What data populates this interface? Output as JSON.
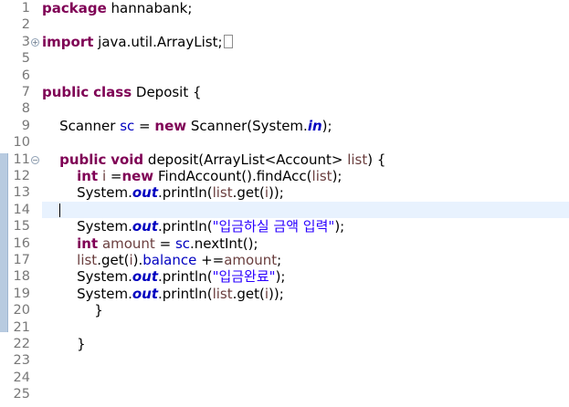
{
  "lines": [
    {
      "num": "1",
      "segments": [
        {
          "t": "package",
          "c": "kw"
        },
        {
          "t": " hannabank;"
        }
      ]
    },
    {
      "num": "2",
      "segments": []
    },
    {
      "num": "3",
      "fold": "+",
      "segments": [
        {
          "t": "import",
          "c": "kw"
        },
        {
          "t": " java.util.ArrayList;"
        }
      ],
      "collapsed": true
    },
    {
      "num": "5",
      "segments": []
    },
    {
      "num": "6",
      "segments": []
    },
    {
      "num": "7",
      "segments": [
        {
          "t": "public",
          "c": "kw"
        },
        {
          "t": " "
        },
        {
          "t": "class",
          "c": "kw"
        },
        {
          "t": " Deposit {"
        }
      ]
    },
    {
      "num": "8",
      "segments": []
    },
    {
      "num": "9",
      "segments": [
        {
          "t": "    Scanner "
        },
        {
          "t": "sc",
          "c": "field"
        },
        {
          "t": " = "
        },
        {
          "t": "new",
          "c": "kw"
        },
        {
          "t": " Scanner(System."
        },
        {
          "t": "in",
          "c": "sfield"
        },
        {
          "t": ");"
        }
      ]
    },
    {
      "num": "10",
      "segments": []
    },
    {
      "num": "11",
      "fold": "−",
      "segments": [
        {
          "t": "    "
        },
        {
          "t": "public",
          "c": "kw"
        },
        {
          "t": " "
        },
        {
          "t": "void",
          "c": "kw"
        },
        {
          "t": " deposit(ArrayList<Account> "
        },
        {
          "t": "list",
          "c": "var"
        },
        {
          "t": ") {"
        }
      ]
    },
    {
      "num": "12",
      "segments": [
        {
          "t": "        "
        },
        {
          "t": "int",
          "c": "kw"
        },
        {
          "t": " "
        },
        {
          "t": "i",
          "c": "var"
        },
        {
          "t": " ="
        },
        {
          "t": "new",
          "c": "kw"
        },
        {
          "t": " FindAccount().findAcc("
        },
        {
          "t": "list",
          "c": "var"
        },
        {
          "t": ");"
        }
      ]
    },
    {
      "num": "13",
      "segments": [
        {
          "t": "        System."
        },
        {
          "t": "out",
          "c": "sfield"
        },
        {
          "t": ".println("
        },
        {
          "t": "list",
          "c": "var"
        },
        {
          "t": ".get("
        },
        {
          "t": "i",
          "c": "var"
        },
        {
          "t": "));"
        }
      ]
    },
    {
      "num": "14",
      "current": true,
      "caret": true,
      "segments": [
        {
          "t": "    "
        }
      ]
    },
    {
      "num": "15",
      "segments": [
        {
          "t": "        System."
        },
        {
          "t": "out",
          "c": "sfield"
        },
        {
          "t": ".println("
        },
        {
          "t": "\"입금하실 금액 입력\"",
          "c": "str"
        },
        {
          "t": ");"
        }
      ]
    },
    {
      "num": "16",
      "segments": [
        {
          "t": "        "
        },
        {
          "t": "int",
          "c": "kw"
        },
        {
          "t": " "
        },
        {
          "t": "amount",
          "c": "var"
        },
        {
          "t": " = "
        },
        {
          "t": "sc",
          "c": "field"
        },
        {
          "t": ".nextInt();"
        }
      ]
    },
    {
      "num": "17",
      "segments": [
        {
          "t": "        "
        },
        {
          "t": "list",
          "c": "var"
        },
        {
          "t": ".get("
        },
        {
          "t": "i",
          "c": "var"
        },
        {
          "t": ")."
        },
        {
          "t": "balance",
          "c": "field"
        },
        {
          "t": " +="
        },
        {
          "t": "amount",
          "c": "var"
        },
        {
          "t": ";"
        }
      ]
    },
    {
      "num": "18",
      "segments": [
        {
          "t": "        System."
        },
        {
          "t": "out",
          "c": "sfield"
        },
        {
          "t": ".println("
        },
        {
          "t": "\"입금완료\"",
          "c": "str"
        },
        {
          "t": ");"
        }
      ]
    },
    {
      "num": "19",
      "segments": [
        {
          "t": "        System."
        },
        {
          "t": "out",
          "c": "sfield"
        },
        {
          "t": ".println("
        },
        {
          "t": "list",
          "c": "var"
        },
        {
          "t": ".get("
        },
        {
          "t": "i",
          "c": "var"
        },
        {
          "t": "));"
        }
      ]
    },
    {
      "num": "20",
      "segments": [
        {
          "t": "            }"
        }
      ]
    },
    {
      "num": "21",
      "segments": []
    },
    {
      "num": "22",
      "segments": [
        {
          "t": "        }"
        }
      ]
    },
    {
      "num": "23",
      "segments": []
    },
    {
      "num": "24",
      "segments": []
    },
    {
      "num": "25",
      "segments": []
    }
  ],
  "colors": {
    "keyword": "#7f0055",
    "field": "#0000c0",
    "local_variable": "#6a3e3e",
    "string": "#2a00ff",
    "line_number": "#787878",
    "current_line": "#e8f2fe",
    "change_bar": "#b8cbe0"
  }
}
